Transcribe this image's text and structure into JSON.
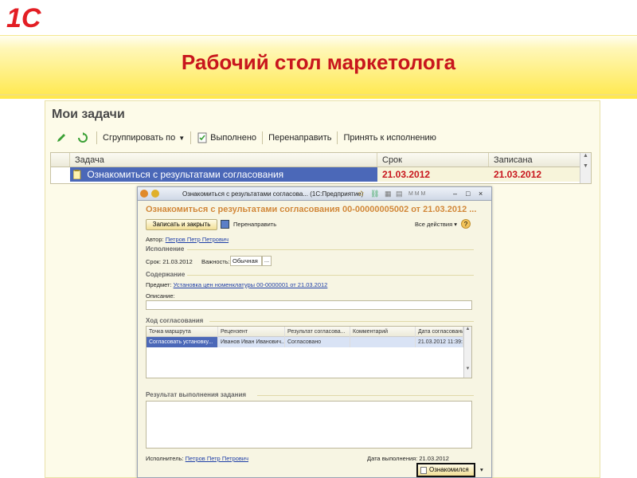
{
  "slide": {
    "logo_text": "1С",
    "title": "Рабочий стол маркетолога"
  },
  "main_window": {
    "title": "Мои задачи",
    "toolbar": {
      "group_by": "Сгруппировать по",
      "done": "Выполнено",
      "redirect": "Перенаправить",
      "accept": "Принять к исполнению"
    },
    "columns": [
      "Задача",
      "Срок",
      "Записана"
    ],
    "rows": [
      {
        "task": "Ознакомиться с результатами согласования",
        "due": "21.03.2012",
        "recorded": "21.03.2012"
      }
    ]
  },
  "dialog": {
    "window_title": "Ознакомиться с результатами согласова... (1С:Предприятие)",
    "header": "Ознакомиться с результатами согласования 00-00000005002 от 21.03.2012 ...",
    "save_close": "Записать и закрыть",
    "redirect": "Перенаправить",
    "all_actions": "Все действия",
    "author_label": "Автор:",
    "author": "Петров Петр Петрович",
    "section_exec": "Исполнение",
    "due_label": "Срок:",
    "due": "21.03.2012",
    "importance_label": "Важность:",
    "importance": "Обычная",
    "section_content": "Содержание",
    "subject_label": "Предмет:",
    "subject": "Установка цен номенклатуры 00-0000001 от 21.03.2012",
    "description_label": "Описание:",
    "section_progress": "Ход согласования",
    "progress_columns": [
      "Точка маршрута",
      "Рецензент",
      "Результат согласова...",
      "Комментарий",
      "Дата согласовани"
    ],
    "progress_rows": [
      {
        "point": "Согласовать установку...",
        "reviewer": "Иванов Иван Иванович...",
        "result": "Согласовано",
        "comment": "",
        "date": "21.03.2012 11:39:"
      }
    ],
    "section_result": "Результат выполнения задания",
    "executor_label": "Исполнитель:",
    "executor": "Петров Петр Петрович",
    "exec_date": "Дата выполнения: 21.03.2012",
    "ack_button": "Ознакомился"
  },
  "colors": {
    "accent_red": "#c8161d",
    "selection_blue": "#4b68b8",
    "orange_header": "#d2883a"
  }
}
